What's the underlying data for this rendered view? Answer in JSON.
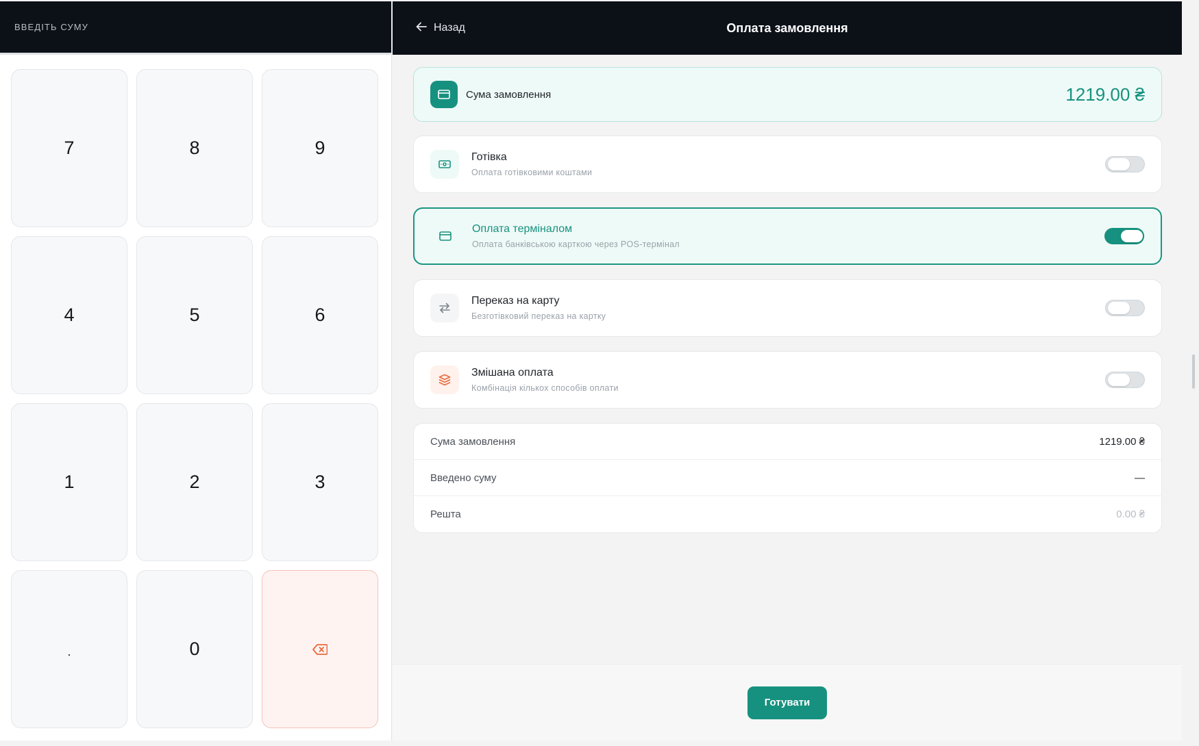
{
  "keypad": {
    "header_label": "ВВЕДІТЬ СУМУ",
    "keys": [
      "7",
      "8",
      "9",
      "4",
      "5",
      "6",
      "1",
      "2",
      "3",
      ".",
      "0"
    ],
    "backspace_icon": "backspace-icon"
  },
  "header": {
    "back_label": "Назад",
    "title": "Оплата замовлення"
  },
  "order_total": {
    "label": "Сума замовлення",
    "value": "1219.00 ₴"
  },
  "payment_methods": [
    {
      "title": "Готівка",
      "subtitle": "Оплата готівковими коштами",
      "icon": "cash-icon",
      "enabled": false
    },
    {
      "title": "Оплата терміналом",
      "subtitle": "Оплата банківською карткою через POS-термінал",
      "icon": "card-icon",
      "enabled": true
    },
    {
      "title": "Переказ на карту",
      "subtitle": "Безготівковий переказ на картку",
      "icon": "transfer-icon",
      "enabled": false
    },
    {
      "title": "Змішана оплата",
      "subtitle": "Комбінація кількох способів оплати",
      "icon": "layers-icon",
      "enabled": false
    }
  ],
  "summary": {
    "rows": [
      {
        "label": "Сума замовлення",
        "value": "1219.00 ₴"
      },
      {
        "label": "Введено суму",
        "value": "—"
      },
      {
        "label": "Решта",
        "value": "0.00 ₴"
      }
    ]
  },
  "footer": {
    "button_label": "Готувати"
  },
  "colors": {
    "accent": "#17917f",
    "dark_header": "#0c1118",
    "active_bg": "#eefaf7",
    "backspace_bg": "#fff3f1",
    "mixed_accent": "#e8693c"
  }
}
